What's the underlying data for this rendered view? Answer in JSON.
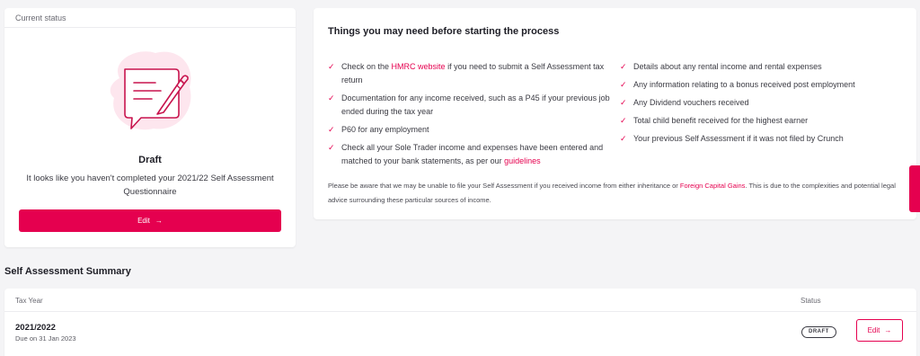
{
  "colors": {
    "accent": "#e5004f",
    "background": "#f4f4f6",
    "card": "#ffffff"
  },
  "status_card": {
    "header": "Current status",
    "title": "Draft",
    "description": "It looks like you haven't completed your 2021/22 Self Assessment Questionnaire",
    "edit_label": "Edit",
    "edit_arrow": "→",
    "illustration_icon": "document-pencil-speech-bubble-icon"
  },
  "needs_card": {
    "title": "Things you may need before starting the process",
    "check_glyph": "✓",
    "left_items": [
      {
        "before": "Check on the ",
        "link": "HMRC website",
        "after": " if you need to submit a Self Assessment tax return"
      },
      {
        "text": "Documentation for any income received, such as a P45 if your previous job ended during the tax year"
      },
      {
        "text": "P60 for any employment"
      },
      {
        "before": "Check all your Sole Trader income and expenses have been entered and matched to your bank statements, as per our ",
        "link": "guidelines",
        "after": ""
      }
    ],
    "right_items": [
      "Details about any rental income and rental expenses",
      "Any information relating to a bonus received post employment",
      "Any Dividend vouchers received",
      "Total child benefit received for the highest earner",
      "Your previous Self Assessment if it was not filed by Crunch"
    ],
    "note": {
      "before": "Please be aware that we may be unable to file your Self Assessment if you received income from either inheritance or ",
      "link": "Foreign Capital Gains",
      "after": ". This is due to the complexities and potential legal advice surrounding these particular sources of income."
    }
  },
  "summary": {
    "title": "Self Assessment Summary",
    "columns": {
      "tax_year": "Tax Year",
      "status": "Status"
    },
    "rows": [
      {
        "tax_year": "2021/2022",
        "due": "Due on 31 Jan 2023",
        "status": "DRAFT",
        "action": "Edit",
        "arrow": "→"
      }
    ]
  }
}
